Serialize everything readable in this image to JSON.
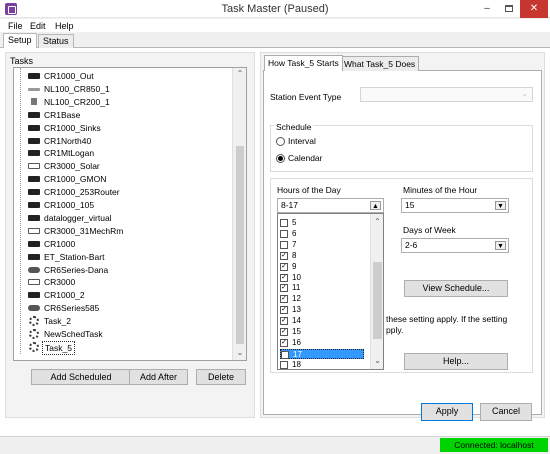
{
  "window": {
    "title": "Task Master (Paused)",
    "min": "–",
    "close": "✕"
  },
  "menu": [
    "File",
    "Edit",
    "Help"
  ],
  "outer_tabs": [
    "Setup",
    "Status"
  ],
  "tasks": {
    "label": "Tasks",
    "items": [
      {
        "label": "CR1000_Out",
        "icon": "logger-icon"
      },
      {
        "label": "NL100_CR850_1",
        "icon": "network-link-icon"
      },
      {
        "label": "NL100_CR200_1",
        "icon": "network-link-icon"
      },
      {
        "label": "CR1Base",
        "icon": "logger-icon"
      },
      {
        "label": "CR1000_Sinks",
        "icon": "logger-icon"
      },
      {
        "label": "CR1North40",
        "icon": "logger-icon"
      },
      {
        "label": "CR1MtLogan",
        "icon": "logger-icon"
      },
      {
        "label": "CR3000_Solar",
        "icon": "cr3000-icon"
      },
      {
        "label": "CR1000_GMON",
        "icon": "logger-icon"
      },
      {
        "label": "CR1000_253Router",
        "icon": "logger-icon"
      },
      {
        "label": "CR1000_105",
        "icon": "logger-icon"
      },
      {
        "label": "datalogger_virtual",
        "icon": "logger-icon"
      },
      {
        "label": "CR3000_31MechRm",
        "icon": "cr3000-icon"
      },
      {
        "label": "CR1000",
        "icon": "logger-icon"
      },
      {
        "label": "ET_Station-Bart",
        "icon": "station-icon"
      },
      {
        "label": "CR6Series-Dana",
        "icon": "cr6-icon"
      },
      {
        "label": "CR3000",
        "icon": "cr3000-icon"
      },
      {
        "label": "CR1000_2",
        "icon": "logger-icon"
      },
      {
        "label": "CR6Series585",
        "icon": "cr6-icon"
      },
      {
        "label": "Task_2",
        "icon": "gear-icon"
      },
      {
        "label": "NewSchedTask",
        "icon": "gear-icon"
      },
      {
        "label": "Task_5",
        "icon": "gear-icon"
      }
    ],
    "selected": "Task_5"
  },
  "buttons": {
    "add_scheduled": "Add Scheduled",
    "add_after": "Add After",
    "delete": "Delete",
    "apply": "Apply",
    "cancel": "Cancel",
    "view_schedule": "View Schedule...",
    "help": "Help..."
  },
  "inner_tabs": [
    "How Task_5 Starts",
    "What Task_5 Does"
  ],
  "station_event_type": {
    "label": "Station Event Type",
    "value": ""
  },
  "schedule": {
    "label": "Schedule",
    "options": [
      {
        "label": "Interval",
        "selected": false
      },
      {
        "label": "Calendar",
        "selected": true
      }
    ]
  },
  "hours": {
    "label": "Hours of the Day",
    "value": "8-17",
    "items": [
      {
        "h": "5",
        "checked": false
      },
      {
        "h": "6",
        "checked": false
      },
      {
        "h": "7",
        "checked": false
      },
      {
        "h": "8",
        "checked": true
      },
      {
        "h": "9",
        "checked": true
      },
      {
        "h": "10",
        "checked": true
      },
      {
        "h": "11",
        "checked": true
      },
      {
        "h": "12",
        "checked": true
      },
      {
        "h": "13",
        "checked": true
      },
      {
        "h": "14",
        "checked": true
      },
      {
        "h": "15",
        "checked": true
      },
      {
        "h": "16",
        "checked": true
      },
      {
        "h": "17",
        "checked": true,
        "selected": true
      },
      {
        "h": "18",
        "checked": false
      }
    ]
  },
  "minutes": {
    "label": "Minutes of the Hour",
    "value": "15"
  },
  "days": {
    "label": "Days of Week",
    "value": "2-6"
  },
  "notes": {
    "line1": "these setting apply. If the setting",
    "line2": "pply."
  },
  "status": {
    "connection": "Connected: localhost",
    "color": "#00d400"
  },
  "icons": {
    "check": "✓",
    "up": "▲",
    "down": "▼",
    "up_small": "⌃",
    "down_small": "⌄"
  }
}
